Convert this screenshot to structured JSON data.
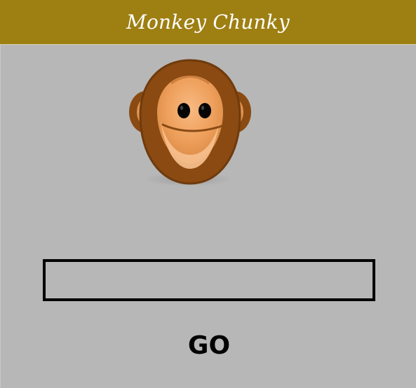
{
  "app": {
    "title": "Monkey Chunky"
  },
  "main": {
    "input_value": "",
    "go_label": "GO",
    "monkey_icon": "monkey-face-icon"
  },
  "colors": {
    "header": "#9d7f12",
    "background": "#b7b7b7",
    "title_text": "#ffffff",
    "border": "#000000"
  }
}
